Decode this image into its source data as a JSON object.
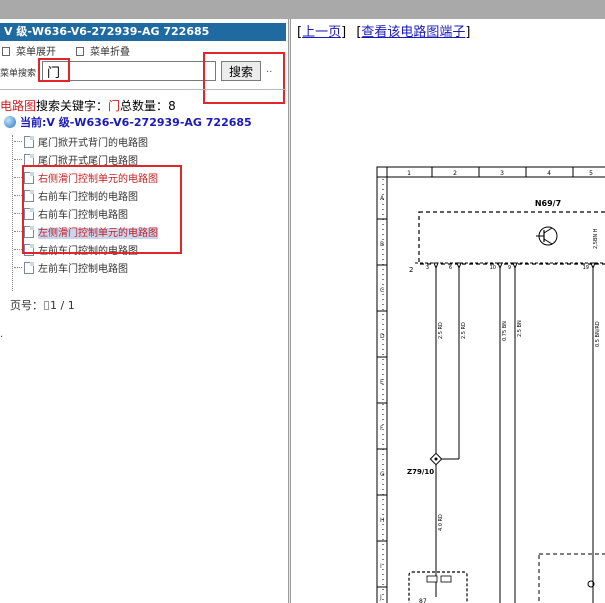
{
  "left_panel": {
    "title": "V 级-W636-V6-272939-AG 722685",
    "menu_expand": "菜单展开",
    "menu_collapse": "菜单折叠",
    "search_label": "菜单搜索",
    "search_value": "门",
    "search_button": "搜索",
    "more": "..",
    "keyword_prefix": "电路图",
    "keyword_label": "搜索关键字：",
    "keyword_value": "门",
    "count_label": "总数量：",
    "count_value": "8",
    "current_label": "当前:V 级-W636-V6-272939-AG 722685",
    "items": [
      "尾门掀开式背门的电路图",
      "尾门掀开式尾门电路图",
      "右侧滑门控制单元的电路图",
      "右前车门控制的电路图",
      "右前车门控制电路图",
      "左侧滑门控制单元的电路图",
      "左前车门控制的电路图",
      "左前车门控制电路图"
    ],
    "page_label": "页号：",
    "page_value": "1 / 1",
    "tiny_mark": "."
  },
  "right_panel": {
    "prev_link": "上一页",
    "terminal_link": "查看该电路图端子",
    "diagram": {
      "component_label": "N69/7",
      "connector_label": "Z79/10",
      "connector_number": "2",
      "row_labels": [
        "A",
        "B",
        "C",
        "D",
        "E",
        "F",
        "G",
        "H",
        "I",
        "J"
      ],
      "col_labels": [
        "1",
        "2",
        "3",
        "4",
        "5"
      ],
      "pins": [
        "3",
        "6",
        "10",
        "9",
        "19"
      ],
      "wires": [
        "2.5 RD",
        "2.5 RD",
        "0.75 BN",
        "2.5 BN",
        "0.5 BN/RD"
      ],
      "wire_lower": "4.0 RD",
      "side_label": "2,5BN H",
      "bottom_label": "87"
    }
  },
  "colors": {
    "titlebar": "#1f6aa0",
    "highlight": "#e0262b",
    "link": "#1a1ab8",
    "selected": "#c9d4ef"
  }
}
